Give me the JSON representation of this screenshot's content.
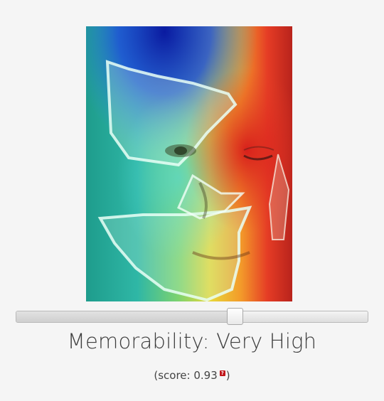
{
  "heatmap": {
    "image_alt": "face heatmap"
  },
  "slider": {
    "value": 0.62
  },
  "result": {
    "label": "Memorability:",
    "value": "Very High"
  },
  "score": {
    "prefix": "(score: ",
    "value": "0.93",
    "help_icon": "question-mark-icon",
    "help_glyph": "?",
    "suffix": ")"
  }
}
